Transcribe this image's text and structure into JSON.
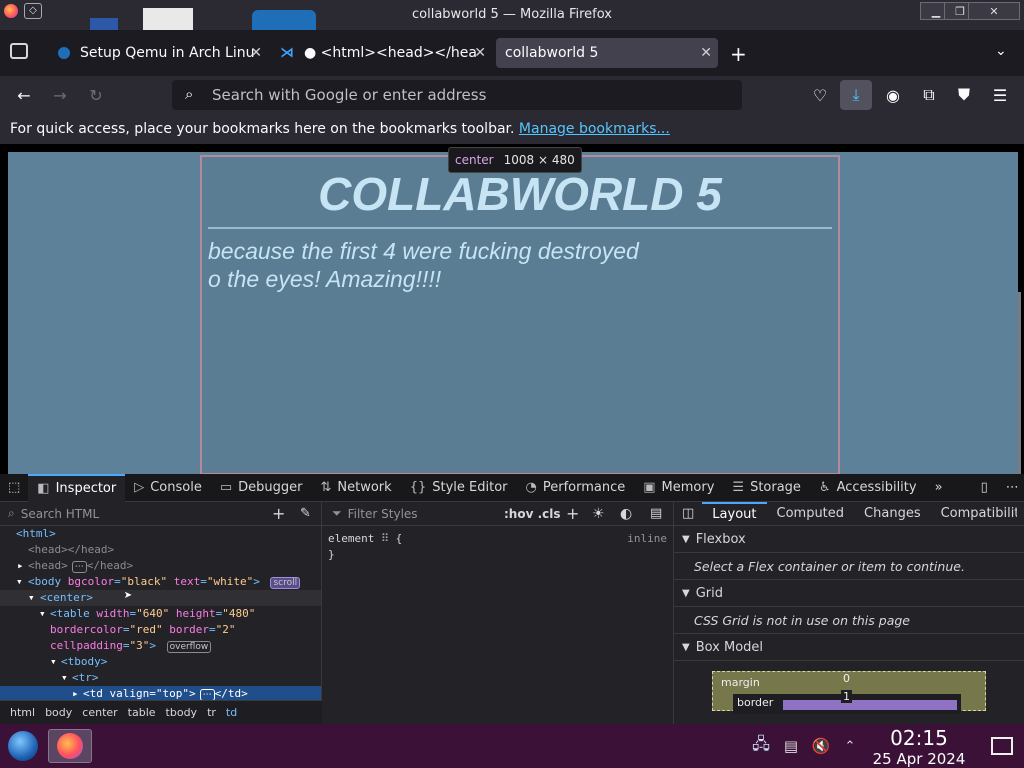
{
  "window": {
    "title": "collabworld 5 — Mozilla Firefox"
  },
  "tabs": [
    {
      "label": "Setup Qemu in Arch Linu",
      "active": false
    },
    {
      "label": "● <html><head></hea",
      "active": false
    },
    {
      "label": "collabworld 5",
      "active": true
    }
  ],
  "urlbar": {
    "placeholder": "Search with Google or enter address"
  },
  "bookmarks_bar": {
    "message": "For quick access, place your bookmarks here on the bookmarks toolbar.",
    "link": "Manage bookmarks..."
  },
  "page": {
    "title": "COLLABWORLD 5",
    "subtitle_line1": "because the first 4 were fucking destroyed",
    "subtitle_line2": "o the eyes! Amazing!!!!",
    "background": "#5d8199",
    "text_color": "#c7e4f4"
  },
  "tooltip": {
    "tag": "center",
    "size": "1008 × 480"
  },
  "devtools": {
    "tabs": [
      "Inspector",
      "Console",
      "Debugger",
      "Network",
      "Style Editor",
      "Performance",
      "Memory",
      "Storage",
      "Accessibility"
    ],
    "search_placeholder": "Search HTML",
    "filter_placeholder": "Filter Styles",
    "hov_cls": ":hov .cls",
    "rule": {
      "selector": "element",
      "brace_open": "{",
      "brace_close": "}",
      "inline_label": "inline"
    },
    "tree": {
      "html": "<html>",
      "head_empty": "<head></head>",
      "head_collapsed_open": "<head>",
      "head_collapsed_close": "</head>",
      "body_tag": "body",
      "body_attr1_name": "bgcolor",
      "body_attr1_val": "\"black\"",
      "body_attr2_name": "text",
      "body_attr2_val": "\"white\"",
      "scroll_badge": "scroll",
      "center": "<center>",
      "table_tag": "table",
      "table_a1n": "width",
      "table_a1v": "\"640\"",
      "table_a2n": "height",
      "table_a2v": "\"480\"",
      "table_a3n": "bordercolor",
      "table_a3v": "\"red\"",
      "table_a4n": "border",
      "table_a4v": "\"2\"",
      "table_a5n": "cellpadding",
      "table_a5v": "\"3\"",
      "overflow_badge": "overflow",
      "tbody": "<tbody>",
      "tr": "<tr>",
      "td_tag": "td",
      "td_an": "valign",
      "td_av": "\"top\"",
      "td_close": "</td>"
    },
    "breadcrumbs": [
      "html",
      "body",
      "center",
      "table",
      "tbody",
      "tr",
      "td"
    ],
    "right_tabs": [
      "Layout",
      "Computed",
      "Changes",
      "Compatibility"
    ],
    "flexbox": {
      "title": "Flexbox",
      "message": "Select a Flex container or item to continue."
    },
    "grid": {
      "title": "Grid",
      "message": "CSS Grid is not in use on this page"
    },
    "box_model": {
      "title": "Box Model",
      "margin_label": "margin",
      "margin_value": "0",
      "border_label": "border",
      "border_value": "1"
    }
  },
  "taskbar": {
    "time": "02:15",
    "date": "25 Apr 2024"
  }
}
